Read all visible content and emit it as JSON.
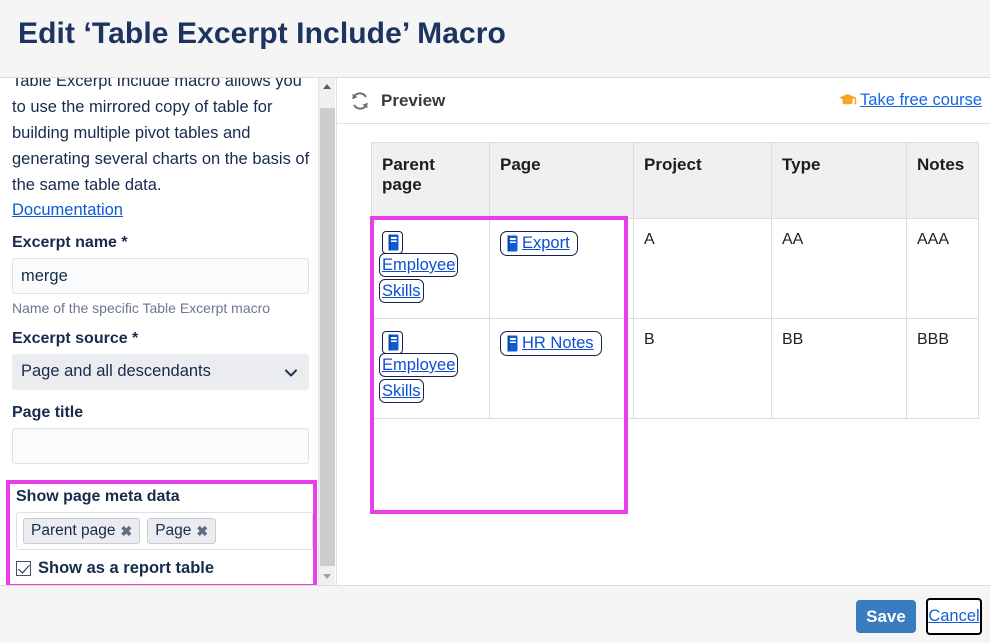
{
  "dialog": {
    "title": "Edit ‘Table Excerpt Include’ Macro"
  },
  "form": {
    "description": "Table Excerpt Include macro allows you to use the mirrored copy of table for building multiple pivot tables and generating several charts on the basis of the same table data.",
    "documentation_link": "Documentation",
    "excerpt_name": {
      "label": "Excerpt name *",
      "value": "merge",
      "placeholder": "",
      "hint": "Name of the specific Table Excerpt macro"
    },
    "excerpt_source": {
      "label": "Excerpt source *",
      "value": "Page and all descendants",
      "chevron_icon": "chevron-down-icon"
    },
    "page_title": {
      "label": "Page title",
      "value": "",
      "placeholder": ""
    },
    "meta_data": {
      "label": "Show page meta data",
      "chips": [
        {
          "label": "Parent page",
          "remove_icon": "✖"
        },
        {
          "label": "Page",
          "remove_icon": "✖"
        }
      ],
      "checkbox_label": "Show as a report table",
      "checked": true
    },
    "highlight_color": "#e83fe8"
  },
  "scrollbar": {
    "up_icon": "chevron-up-icon",
    "down_icon": "chevron-down-icon"
  },
  "preview": {
    "refresh_icon": "refresh-icon",
    "label": "Preview",
    "course_link": {
      "icon": "graduation-cap-icon",
      "text": "Take free course"
    },
    "table": {
      "columns": [
        "Parent page",
        "Page",
        "Project",
        "Type",
        "Notes"
      ],
      "rows": [
        {
          "parent_page": {
            "icon": "page-document-icon",
            "text": "Employee Skills"
          },
          "page": {
            "icon": "page-document-icon",
            "text": "Export"
          },
          "project": "A",
          "type": "AA",
          "notes": "AAA"
        },
        {
          "parent_page": {
            "icon": "page-document-icon",
            "text": "Employee Skills"
          },
          "page": {
            "icon": "page-document-icon",
            "text": "HR Notes"
          },
          "project": "B",
          "type": "BB",
          "notes": "BBB"
        }
      ]
    }
  },
  "footer": {
    "save_label": "Save",
    "cancel_label": "Cancel",
    "save_color": "#3b7bbf"
  }
}
